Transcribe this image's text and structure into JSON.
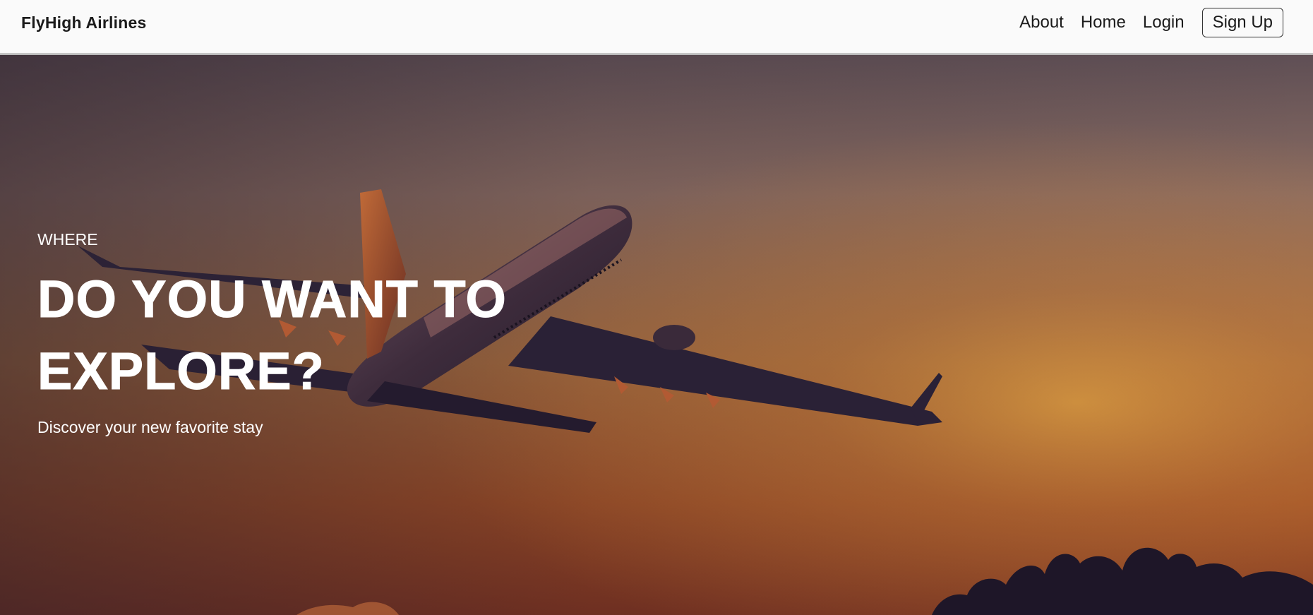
{
  "navbar": {
    "brand": "FlyHigh Airlines",
    "links": [
      "About",
      "Home",
      "Login"
    ],
    "signup_label": "Sign Up"
  },
  "hero": {
    "eyebrow": "WHERE",
    "headline_line1": "DO YOU WANT TO",
    "headline_line2": "EXPLORE?",
    "subtitle": "Discover your new favorite stay",
    "image": "airplane-sunset-photo"
  },
  "colors": {
    "navbar_bg": "#fafafa",
    "text_dark": "#1b1b1b",
    "hero_text": "#ffffff",
    "sky_top": "#6e5a5c",
    "sky_bottom": "#8a3a1e"
  }
}
